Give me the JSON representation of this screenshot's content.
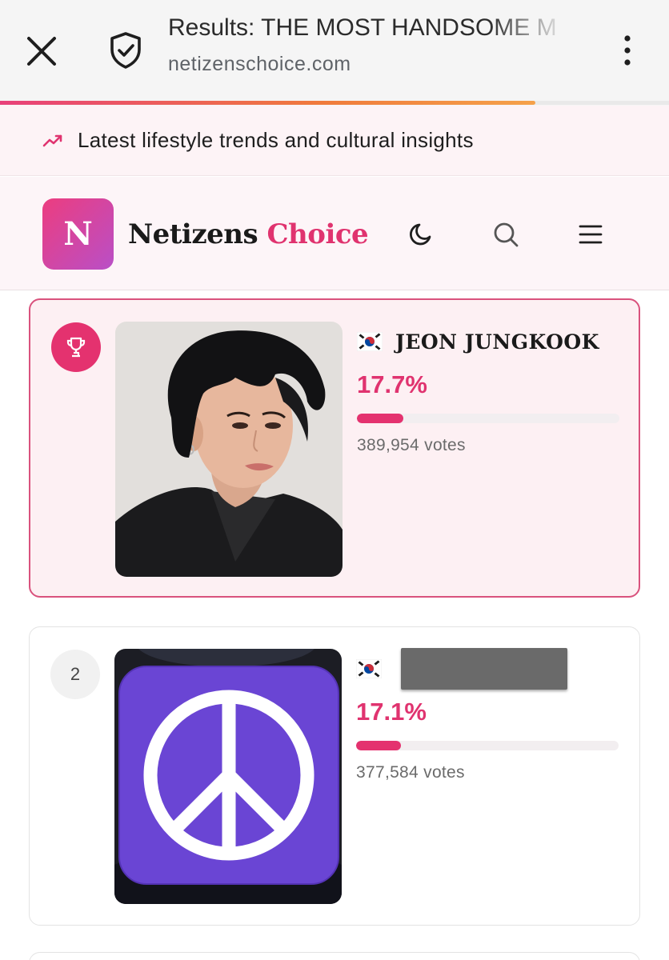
{
  "browser": {
    "page_title": "Results: THE MOST HANDSOME M",
    "url": "netizenschoice.com",
    "load_progress": 0.8
  },
  "trend_bar": {
    "text": "Latest lifestyle trends and cultural insights",
    "icon": "trending-up-icon"
  },
  "header": {
    "logo_letter": "N",
    "brand_part1": "Netizens",
    "brand_part2": "Choice",
    "icons": [
      "moon-icon",
      "search-icon",
      "menu-icon"
    ]
  },
  "results": [
    {
      "rank": 1,
      "rank_icon": "trophy-icon",
      "flag": "south-korea-flag",
      "name": "JEON JUNGKOOK",
      "percent_label": "17.7%",
      "percent": 17.7,
      "votes": "389,954 votes"
    },
    {
      "rank": 2,
      "rank_label": "2",
      "flag": "south-korea-flag",
      "name": "",
      "percent_label": "17.1%",
      "percent": 17.1,
      "votes": "377,584 votes"
    }
  ],
  "colors": {
    "accent": "#e0336f",
    "logo_gradient_start": "#ec3d7f",
    "logo_gradient_end": "#b94fc7",
    "peace_badge": "#6a45d4"
  }
}
